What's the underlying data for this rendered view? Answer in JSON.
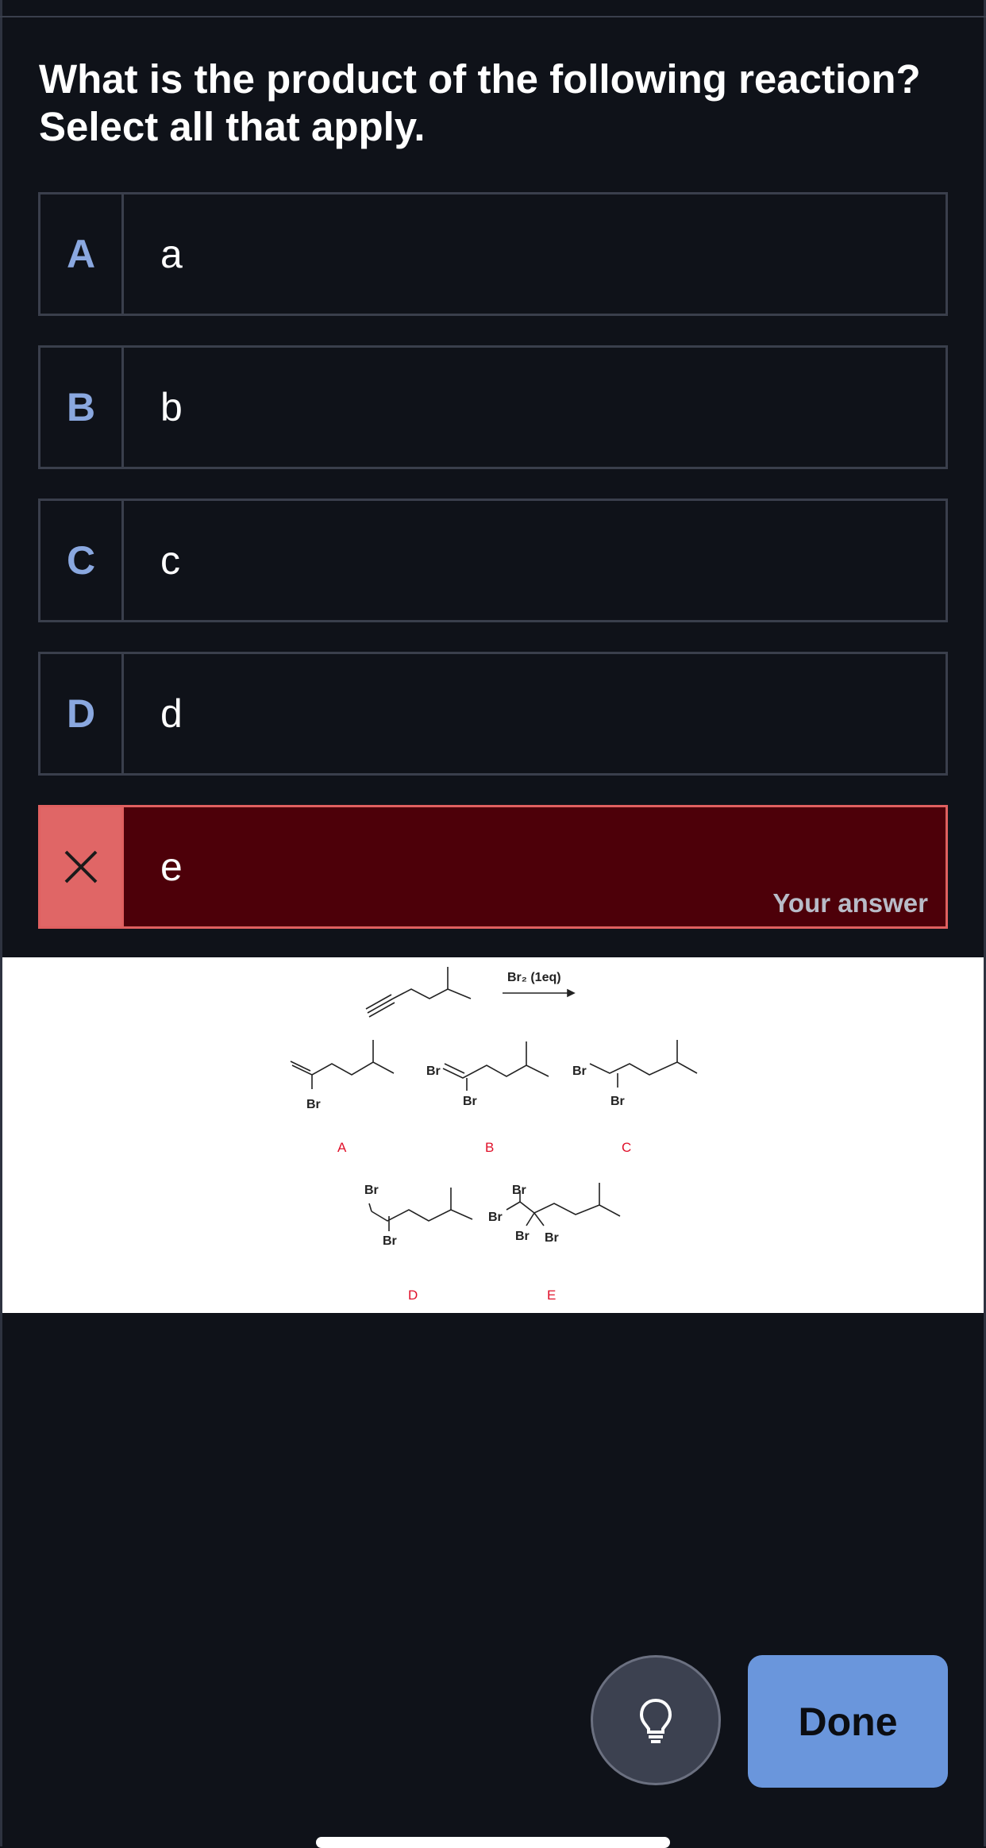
{
  "question": {
    "line1": "What is the product of the following reaction?",
    "line2": "Select all that apply."
  },
  "options": [
    {
      "letter": "A",
      "text": "a"
    },
    {
      "letter": "B",
      "text": "b"
    },
    {
      "letter": "C",
      "text": "c"
    },
    {
      "letter": "D",
      "text": "d"
    },
    {
      "letter": "✕",
      "text": "e",
      "status": "incorrect",
      "note": "Your answer"
    }
  ],
  "figure": {
    "reagent": "Br₂ (1eq)",
    "substituent": "Br",
    "labels": [
      "A",
      "B",
      "C",
      "D",
      "E"
    ]
  },
  "buttons": {
    "hint_icon": "lightbulb-icon",
    "done_label": "Done"
  },
  "colors": {
    "background": "#0f1219",
    "accent": "#6a96dc",
    "wrong_bg": "#4d0009",
    "wrong_marker": "#e06666",
    "letter_color": "#8aa8e0"
  }
}
